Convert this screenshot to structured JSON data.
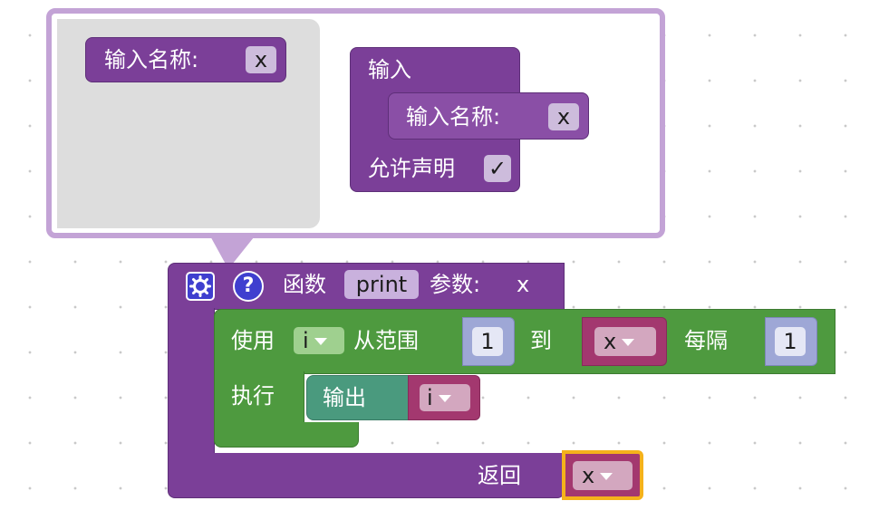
{
  "mutator": {
    "palette_block_label": "输入名称:",
    "palette_block_value": "x",
    "container_label": "输入",
    "item_label": "输入名称:",
    "item_value": "x",
    "allow_statements_label": "允许声明",
    "allow_statements_check": "✓"
  },
  "function_block": {
    "settings_icon": "gear-icon",
    "help_icon_text": "?",
    "label": "函数",
    "name": "print",
    "params_label": "参数:",
    "params_value": "x",
    "return_label": "返回",
    "return_var": "x"
  },
  "for_block": {
    "label_use": "使用",
    "var": "i",
    "label_from": "从范围",
    "from_value": "1",
    "label_to": "到",
    "to_var": "x",
    "label_step": "每隔",
    "step_value": "1",
    "label_do": "执行"
  },
  "print_block": {
    "label": "输出",
    "var": "i"
  },
  "colors": {
    "procedure": "#7b3f98",
    "loop": "#4e9a3f",
    "text": "#4a9a7e",
    "selected_outline": "#f5b21b"
  }
}
